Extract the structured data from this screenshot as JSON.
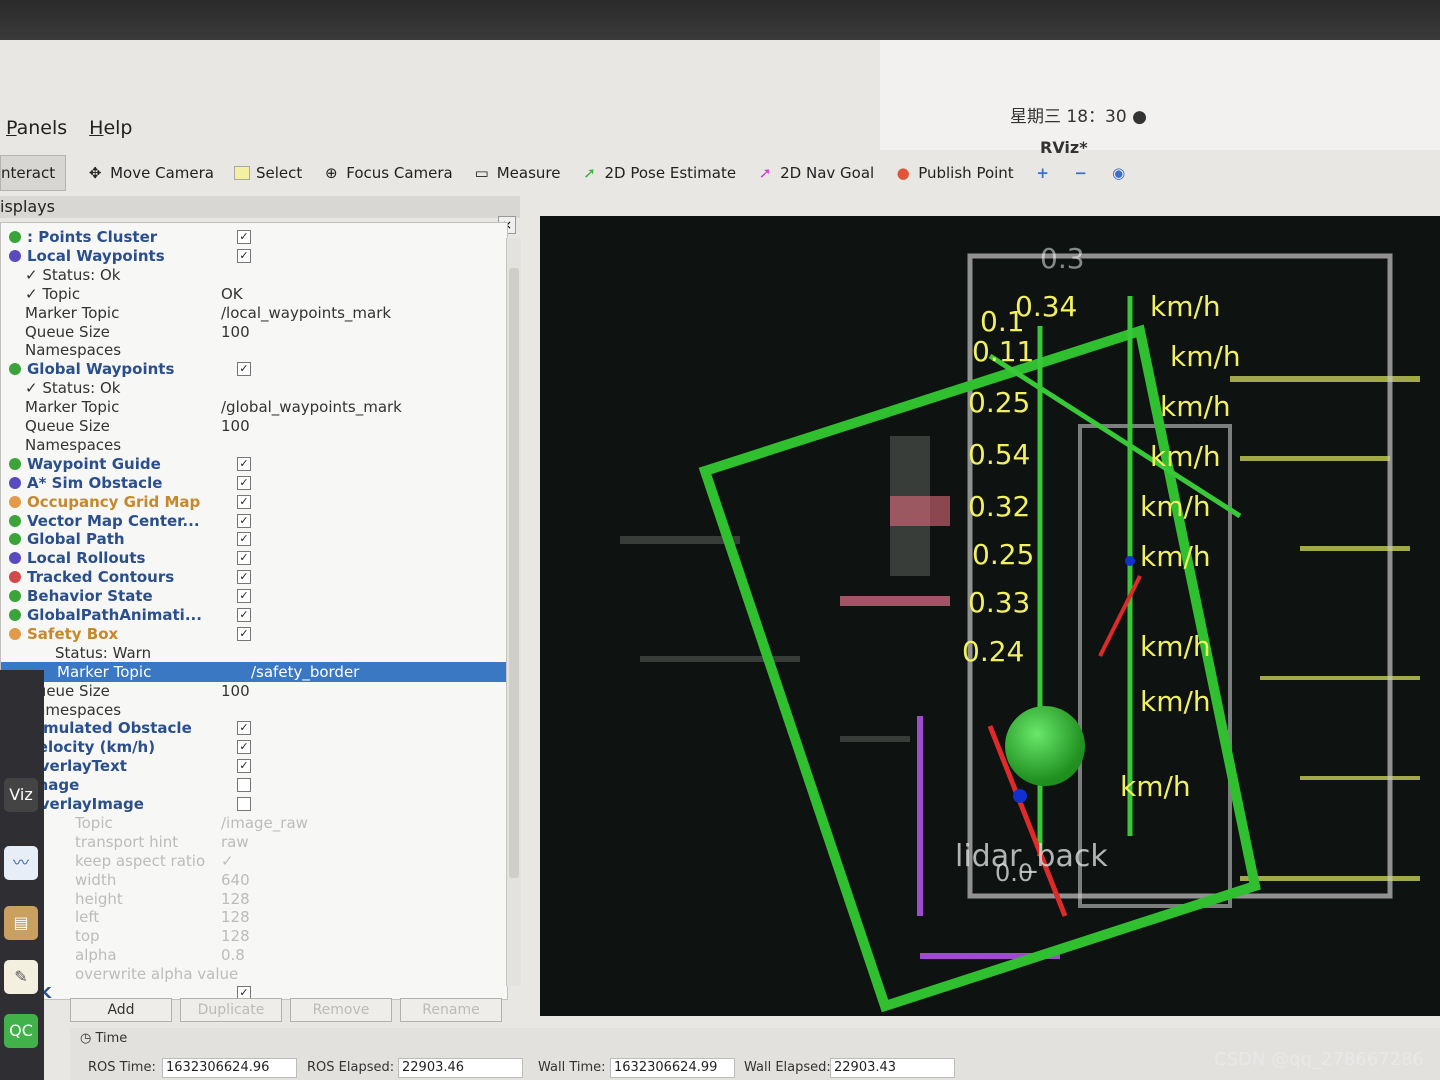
{
  "system": {
    "clock": "星期三 18：30 ●",
    "window_title": "RViz*"
  },
  "menu": [
    "Panels",
    "Help"
  ],
  "toolbar": {
    "interact": "nteract",
    "move_camera": "Move Camera",
    "select": "Select",
    "focus_camera": "Focus Camera",
    "measure": "Measure",
    "pose_estimate": "2D Pose Estimate",
    "nav_goal": "2D Nav Goal",
    "publish_point": "Publish Point"
  },
  "panel": {
    "title": "isplays",
    "close": "×"
  },
  "tree": [
    {
      "label": ": Points Cluster",
      "checked": true,
      "kind": "disp"
    },
    {
      "label": "Local Waypoints",
      "checked": true,
      "kind": "disp"
    },
    {
      "label": "✓ Status: Ok",
      "kind": "plain"
    },
    {
      "label": "✓ Topic",
      "value": "OK",
      "kind": "plain"
    },
    {
      "label": "Marker Topic",
      "value": "/local_waypoints_mark",
      "kind": "plain"
    },
    {
      "label": "Queue Size",
      "value": "100",
      "kind": "plain"
    },
    {
      "label": "Namespaces",
      "kind": "plain"
    },
    {
      "label": "Global Waypoints",
      "checked": true,
      "kind": "disp"
    },
    {
      "label": "✓ Status: Ok",
      "kind": "plain"
    },
    {
      "label": "Marker Topic",
      "value": "/global_waypoints_mark",
      "kind": "plain"
    },
    {
      "label": "Queue Size",
      "value": "100",
      "kind": "plain"
    },
    {
      "label": "Namespaces",
      "kind": "plain"
    },
    {
      "label": "Waypoint Guide",
      "checked": true,
      "kind": "disp"
    },
    {
      "label": "A* Sim Obstacle",
      "checked": true,
      "kind": "disp"
    },
    {
      "label": "Occupancy Grid Map",
      "checked": true,
      "kind": "warn"
    },
    {
      "label": "Vector Map Center...",
      "checked": true,
      "kind": "disp"
    },
    {
      "label": "Global Path",
      "checked": true,
      "kind": "disp"
    },
    {
      "label": "Local Rollouts",
      "checked": true,
      "kind": "disp"
    },
    {
      "label": "Tracked Contours",
      "checked": true,
      "kind": "disp"
    },
    {
      "label": "Behavior State",
      "checked": true,
      "kind": "disp"
    },
    {
      "label": "GlobalPathAnimati...",
      "checked": true,
      "kind": "disp"
    },
    {
      "label": "Safety Box",
      "checked": true,
      "kind": "warn"
    },
    {
      "label": "Status: Warn",
      "kind": "warnsub"
    },
    {
      "label": "Marker Topic",
      "value": "/safety_border",
      "kind": "sel"
    },
    {
      "label": "Queue Size",
      "value": "100",
      "kind": "plain"
    },
    {
      "label": "Namespaces",
      "kind": "plain"
    },
    {
      "label": "Simulated Obstacle",
      "checked": true,
      "kind": "disp"
    },
    {
      "label": "Velocity (km/h)",
      "checked": true,
      "kind": "disp"
    },
    {
      "label": "OverlayText",
      "checked": true,
      "kind": "disp"
    },
    {
      "label": "Image",
      "checked": false,
      "kind": "disp"
    },
    {
      "label": "OverlayImage",
      "checked": false,
      "kind": "disp"
    },
    {
      "label": "Topic",
      "value": "/image_raw",
      "kind": "faded"
    },
    {
      "label": "transport hint",
      "value": "raw",
      "kind": "faded"
    },
    {
      "label": "keep aspect ratio",
      "value": "✓",
      "kind": "faded"
    },
    {
      "label": "width",
      "value": "640",
      "kind": "faded"
    },
    {
      "label": "height",
      "value": "128",
      "kind": "faded"
    },
    {
      "label": "left",
      "value": "128",
      "kind": "faded"
    },
    {
      "label": "top",
      "value": "128",
      "kind": "faded"
    },
    {
      "label": "alpha",
      "value": "0.8",
      "kind": "faded"
    },
    {
      "label": "overwrite alpha value",
      "value": "",
      "kind": "faded"
    },
    {
      "label": "OK",
      "checked": true,
      "kind": "disp"
    }
  ],
  "buttons": {
    "add": "Add",
    "duplicate": "Duplicate",
    "remove": "Remove",
    "rename": "Rename"
  },
  "time": {
    "header": "Time",
    "ros_time_label": "ROS Time:",
    "ros_time": "1632306624.96",
    "ros_elapsed_label": "ROS Elapsed:",
    "ros_elapsed": "22903.46",
    "wall_time_label": "Wall Time:",
    "wall_time": "1632306624.99",
    "wall_elapsed_label": "Wall Elapsed:",
    "wall_elapsed": "22903.43"
  },
  "viewport": {
    "speed_labels": [
      "0.3",
      "0.1",
      "0.34",
      "0.11",
      "0.25",
      "0.54",
      "0.32",
      "0.25",
      "0.33",
      "0.24",
      "0.0"
    ],
    "km_h": "km/h",
    "lidar_label": "lidar_back",
    "zero": "0.0"
  },
  "dock_apps": [
    "Viz",
    "Q",
    "QC"
  ],
  "watermark": "CSDN @qq_278667286",
  "colors": {
    "accent_blue": "#3a78c3",
    "box_green": "#2fbf2f",
    "text_yellow": "#f0f060"
  }
}
